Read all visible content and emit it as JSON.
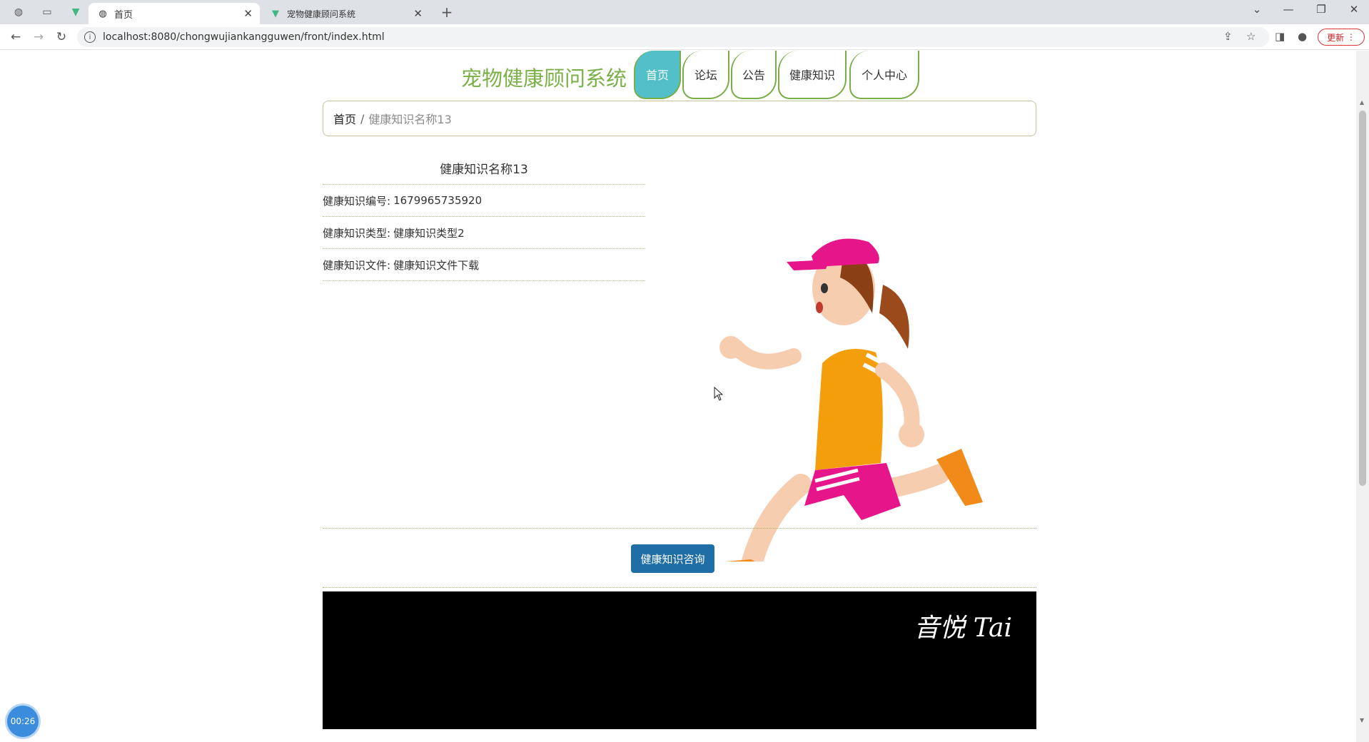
{
  "browser": {
    "tabs": [
      {
        "label": "首页",
        "icon": "globe-icon"
      },
      {
        "label": "宠物健康顾问系统",
        "icon": "vue-icon"
      }
    ],
    "url": "localhost:8080/chongwujiankangguwen/front/index.html",
    "update_label": "更新"
  },
  "site": {
    "title": "宠物健康顾问系统",
    "nav": [
      {
        "label": "首页",
        "active": true
      },
      {
        "label": "论坛",
        "active": false
      },
      {
        "label": "公告",
        "active": false
      },
      {
        "label": "健康知识",
        "active": false
      },
      {
        "label": "个人中心",
        "active": false
      }
    ]
  },
  "breadcrumb": {
    "home": "首页",
    "separator": "/",
    "current": "健康知识名称13"
  },
  "knowledge": {
    "title": "健康知识名称13",
    "fields": [
      {
        "label": "健康知识编号:",
        "value": "1679965735920"
      },
      {
        "label": "健康知识类型:",
        "value": "健康知识类型2"
      },
      {
        "label": "健康知识文件:",
        "value": "健康知识文件下载"
      }
    ],
    "consult_button": "健康知识咨询"
  },
  "video": {
    "watermark": "音悦 Tai"
  },
  "timer": "00:26",
  "colors": {
    "brand_green": "#7bb049",
    "nav_active": "#53bfc9",
    "button_blue": "#1f6fa6"
  }
}
